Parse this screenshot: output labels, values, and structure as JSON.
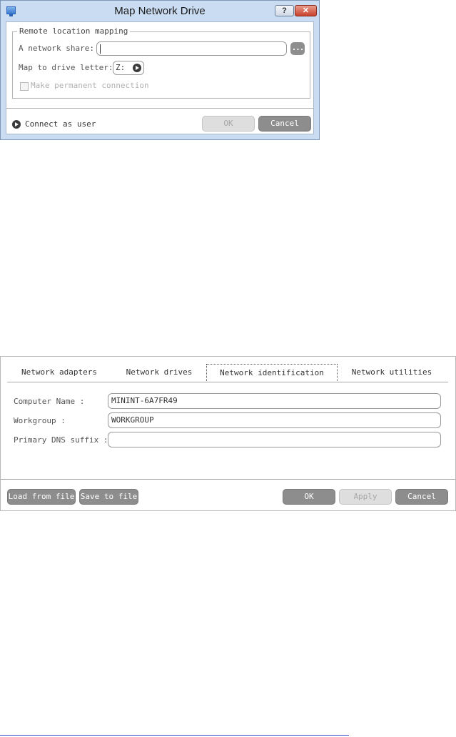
{
  "map_dialog": {
    "title": "Map Network Drive",
    "help_button": "?",
    "close_button": "✕",
    "group_label": "Remote location mapping",
    "network_share_label": "A network share:",
    "network_share_value": "",
    "browse_button": "...",
    "drive_letter_label": "Map to drive letter:",
    "drive_letter_value": "Z:",
    "permanent_label": "Make permanent connection",
    "permanent_checked": false,
    "connect_as_label": "Connect as user",
    "ok_button": "OK",
    "cancel_button": "Cancel"
  },
  "network_panel": {
    "tabs": [
      {
        "label": "Network adapters",
        "active": false
      },
      {
        "label": "Network drives",
        "active": false
      },
      {
        "label": "Network identification",
        "active": true
      },
      {
        "label": "Network utilities",
        "active": false
      }
    ],
    "computer_name_label": "Computer Name :",
    "computer_name_value": "MININT-6A7FR49",
    "workgroup_label": "Workgroup :",
    "workgroup_value": "WORKGROUP",
    "dns_suffix_label": "Primary DNS suffix :",
    "dns_suffix_value": "",
    "load_button": "Load from file",
    "save_button": "Save to file",
    "ok_button": "OK",
    "apply_button": "Apply",
    "cancel_button": "Cancel"
  },
  "colors": {
    "dialog_frame": "#c9dcf1",
    "button_gray": "#8d8d8d",
    "button_disabled": "#dedede"
  }
}
